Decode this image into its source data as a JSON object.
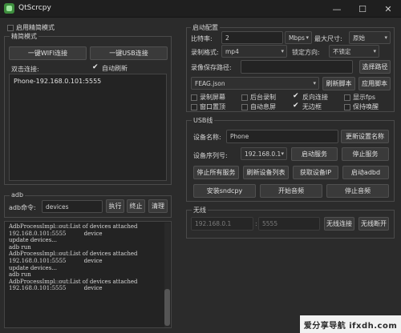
{
  "window": {
    "title": "QtScrcpy",
    "minimize": "—",
    "maximize": "☐",
    "close": "✕"
  },
  "simple_mode": {
    "label": "启用精简模式",
    "checked": false
  },
  "simple_group": {
    "title": "精简模式",
    "wifi_button": "一键WIFI连接",
    "usb_button": "一键USB连接",
    "double_click_label": "双击连接:",
    "auto_refresh": {
      "label": "自动刷新",
      "checked": true
    },
    "devices": [
      "Phone-192.168.0.101:5555"
    ]
  },
  "adb_group": {
    "title": "adb",
    "command_label": "adb命令:",
    "command_value": "devices",
    "execute_button": "执行",
    "stop_button": "终止",
    "clear_button": "清理"
  },
  "console_lines": [
    "AdbProcessImpl::out:List of devices attached",
    "192.168.0.101:5555          device",
    "",
    "update devices...",
    "adb run",
    "AdbProcessImpl::out:List of devices attached",
    "192.168.0.101:5555          device",
    "",
    "update devices...",
    "adb run",
    "AdbProcessImpl::out:List of devices attached",
    "192.168.0.101:5555          device"
  ],
  "start_config": {
    "title": "启动配置",
    "bitrate_label": "比特率:",
    "bitrate_value": "2",
    "bitrate_unit": "Mbps",
    "max_size_label": "最大尺寸:",
    "max_size_value": "原始",
    "record_format_label": "录制格式:",
    "record_format_value": "mp4",
    "lock_orientation_label": "锁定方向:",
    "lock_orientation_value": "不锁定",
    "record_path_label": "录像保存路径:",
    "record_path_value": "",
    "select_path_button": "选择路径",
    "script_value": "FEAG.json",
    "refresh_script_button": "刷新脚本",
    "apply_script_button": "应用脚本",
    "options": [
      {
        "label": "录制屏幕",
        "checked": false
      },
      {
        "label": "后台录制",
        "checked": false
      },
      {
        "label": "反向连接",
        "checked": true
      },
      {
        "label": "显示fps",
        "checked": false
      },
      {
        "label": "窗口置顶",
        "checked": false
      },
      {
        "label": "自动息屏",
        "checked": false
      },
      {
        "label": "无边框",
        "checked": true
      },
      {
        "label": "保持唤醒",
        "checked": false
      }
    ]
  },
  "usb_group": {
    "title": "USB线",
    "device_name_label": "设备名称:",
    "device_name_value": "Phone",
    "update_name_button": "更新设置名称",
    "serial_label": "设备序列号:",
    "serial_value": "192.168.0.1",
    "start_service_button": "启动服务",
    "stop_service_button": "停止服务",
    "stop_all_button": "停止所有服务",
    "refresh_devices_button": "刷新设备列表",
    "get_ip_button": "获取设备IP",
    "start_adbd_button": "启动adbd",
    "install_button": "安装sndcpy",
    "start_audio_button": "开始音频",
    "stop_audio_button": "停止音频"
  },
  "wireless_group": {
    "title": "无线",
    "ip_value": "192.168.0.1",
    "port_value": "5555",
    "connect_button": "无线连接",
    "disconnect_button": "无线断开"
  },
  "watermark": "爱分享导航 ifxdh.com"
}
